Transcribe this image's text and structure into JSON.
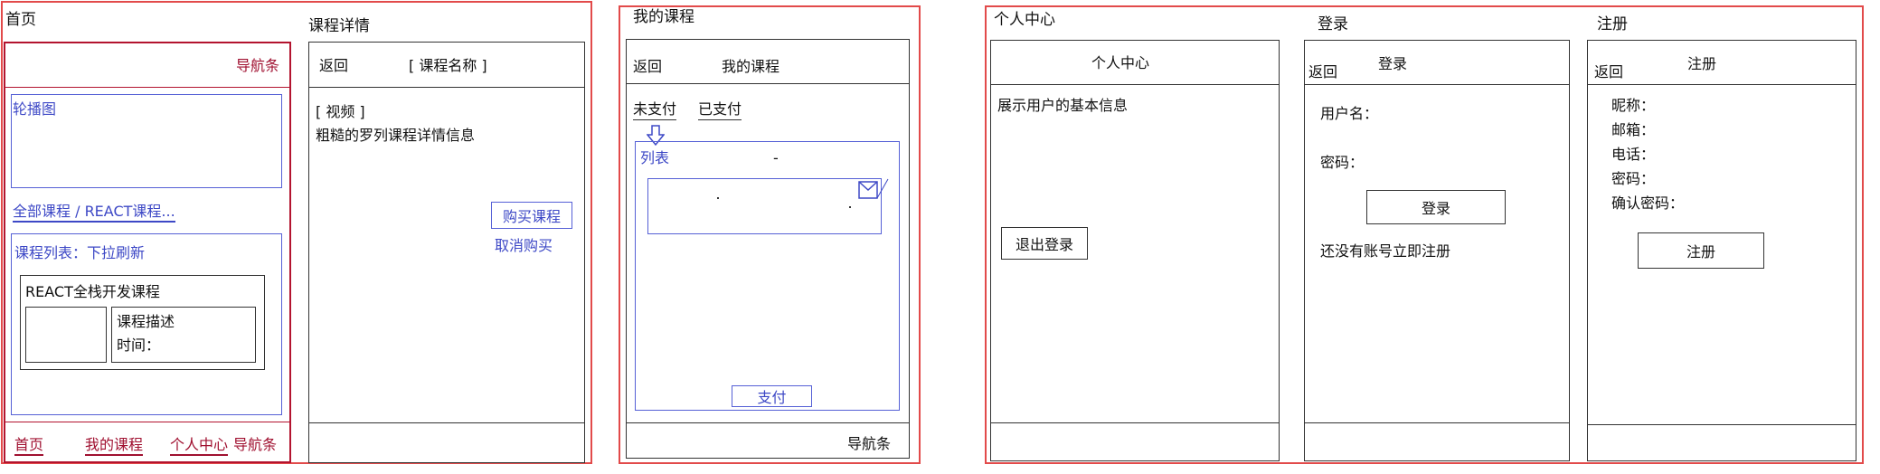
{
  "home": {
    "title": "首页",
    "nav_top": "导航条",
    "carousel": "轮播图",
    "category_link": "全部课程 / REACT课程...",
    "course_list_title": "课程列表：下拉刷新",
    "course_card": {
      "name": "REACT全栈开发课程",
      "desc": "课程描述",
      "time": "时间："
    },
    "bottom_nav": {
      "home": "首页",
      "my_courses": "我的课程",
      "profile": "个人中心",
      "label": "导航条"
    }
  },
  "detail": {
    "title": "课程详情",
    "back": "返回",
    "course_name": "[ 课程名称 ]",
    "video": "[ 视频 ]",
    "info": "粗糙的罗列课程详情信息",
    "buy": "购买课程",
    "cancel": "取消购买"
  },
  "my_courses": {
    "title": "我的课程",
    "back": "返回",
    "header": "我的课程",
    "tab_unpaid": "未支付",
    "tab_paid": "已支付",
    "list_label": "列表",
    "list_dash": "-",
    "pay": "支付",
    "nav": "导航条"
  },
  "profile": {
    "title": "个人中心",
    "header": "个人中心",
    "info": "展示用户的基本信息",
    "logout": "退出登录"
  },
  "login": {
    "title": "登录",
    "back": "返回",
    "header": "登录",
    "username": "用户名：",
    "password": "密码：",
    "submit": "登录",
    "register_hint": "还没有账号立即注册"
  },
  "register": {
    "title": "注册",
    "back": "返回",
    "header": "注册",
    "fields": [
      "昵称：",
      "邮箱：",
      "电话：",
      "密码：",
      "确认密码："
    ],
    "submit": "注册"
  }
}
